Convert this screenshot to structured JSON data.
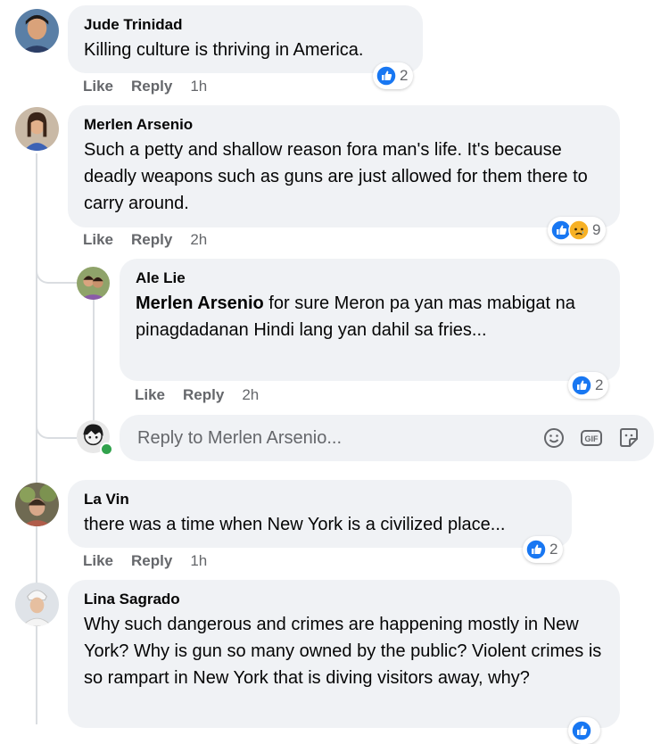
{
  "comments": [
    {
      "author": "Jude Trinidad",
      "text": "Killing culture is thriving in America.",
      "like_label": "Like",
      "reply_label": "Reply",
      "time": "1h",
      "reactions": {
        "types": [
          "like"
        ],
        "count": "2"
      }
    },
    {
      "author": "Merlen Arsenio",
      "text": "Such a petty and shallow reason fora man's life. It's because deadly weapons such as guns are just allowed for them there to carry around.",
      "like_label": "Like",
      "reply_label": "Reply",
      "time": "2h",
      "reactions": {
        "types": [
          "like",
          "sad"
        ],
        "count": "9"
      },
      "replies": [
        {
          "author": "Ale Lie",
          "mention": "Merlen Arsenio",
          "text": " for sure Meron pa yan mas mabigat na pinagdadanan Hindi lang yan dahil sa fries...",
          "like_label": "Like",
          "reply_label": "Reply",
          "time": "2h",
          "reactions": {
            "types": [
              "like"
            ],
            "count": "2"
          }
        }
      ],
      "reply_input": {
        "placeholder": "Reply to Merlen Arsenio...",
        "tools": [
          "emoji-icon",
          "gif-icon",
          "sticker-icon"
        ]
      }
    },
    {
      "author": "La Vin",
      "text": "there was a time when New York is a civilized place...",
      "like_label": "Like",
      "reply_label": "Reply",
      "time": "1h",
      "reactions": {
        "types": [
          "like"
        ],
        "count": "2"
      }
    },
    {
      "author": "Lina Sagrado",
      "text": "Why such dangerous and crimes are happening mostly in New York? Why is gun so many owned by the public? Violent crimes is so rampart in New York that is diving visitors away, why?",
      "reactions": {
        "types": [
          "like"
        ],
        "count": ""
      }
    }
  ],
  "colors": {
    "bubble": "#f0f2f5",
    "meta_text": "#65676b",
    "like_blue": "#1877f2",
    "sad_yellow": "#f7b125",
    "online_green": "#31a24c"
  }
}
